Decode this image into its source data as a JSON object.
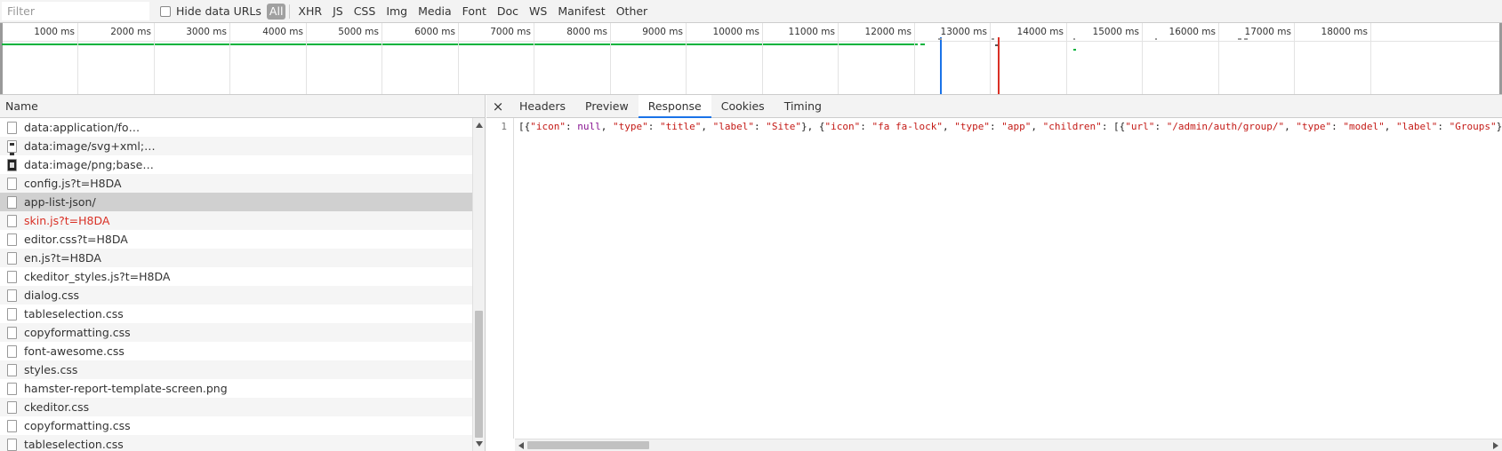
{
  "filterbar": {
    "filter_placeholder": "Filter",
    "hide_data_urls_label": "Hide data URLs",
    "types": [
      "All",
      "XHR",
      "JS",
      "CSS",
      "Img",
      "Media",
      "Font",
      "Doc",
      "WS",
      "Manifest",
      "Other"
    ],
    "active_type": "All"
  },
  "overview": {
    "ticks": [
      "1000 ms",
      "2000 ms",
      "3000 ms",
      "4000 ms",
      "5000 ms",
      "6000 ms",
      "7000 ms",
      "8000 ms",
      "9000 ms",
      "10000 ms",
      "11000 ms",
      "12000 ms",
      "13000 ms",
      "14000 ms",
      "15000 ms",
      "16000 ms",
      "17000 ms",
      "18000 ms"
    ],
    "dom_content_loaded_color": "#1a73e8",
    "load_color": "#d93025",
    "request_bar_color": "#00b33c"
  },
  "requests": {
    "header": "Name",
    "items": [
      {
        "name": "data:application/fo…",
        "icon": "file-icon",
        "state": "normal"
      },
      {
        "name": "data:image/svg+xml;…",
        "icon": "svg-file-icon",
        "state": "normal"
      },
      {
        "name": "data:image/png;base…",
        "icon": "png-file-icon",
        "state": "normal"
      },
      {
        "name": "config.js?t=H8DA",
        "icon": "file-icon",
        "state": "normal"
      },
      {
        "name": "app-list-json/",
        "icon": "file-icon",
        "state": "selected"
      },
      {
        "name": "skin.js?t=H8DA",
        "icon": "file-icon",
        "state": "error"
      },
      {
        "name": "editor.css?t=H8DA",
        "icon": "file-icon",
        "state": "normal"
      },
      {
        "name": "en.js?t=H8DA",
        "icon": "file-icon",
        "state": "normal"
      },
      {
        "name": "ckeditor_styles.js?t=H8DA",
        "icon": "file-icon",
        "state": "normal"
      },
      {
        "name": "dialog.css",
        "icon": "file-icon",
        "state": "normal"
      },
      {
        "name": "tableselection.css",
        "icon": "file-icon",
        "state": "normal"
      },
      {
        "name": "copyformatting.css",
        "icon": "file-icon",
        "state": "normal"
      },
      {
        "name": "font-awesome.css",
        "icon": "file-icon",
        "state": "normal"
      },
      {
        "name": "styles.css",
        "icon": "file-icon",
        "state": "normal"
      },
      {
        "name": "hamster-report-template-screen.png",
        "icon": "file-icon",
        "state": "normal"
      },
      {
        "name": "ckeditor.css",
        "icon": "file-icon",
        "state": "normal"
      },
      {
        "name": "copyformatting.css",
        "icon": "file-icon",
        "state": "normal"
      },
      {
        "name": "tableselection.css",
        "icon": "file-icon",
        "state": "normal"
      }
    ]
  },
  "detail": {
    "close_label": "×",
    "tabs": [
      "Headers",
      "Preview",
      "Response",
      "Cookies",
      "Timing"
    ],
    "active_tab": "Response",
    "line_number": "1",
    "response_tokens": [
      {
        "t": "punc",
        "v": "[{"
      },
      {
        "t": "str",
        "v": "\"icon\""
      },
      {
        "t": "punc",
        "v": ": "
      },
      {
        "t": "null",
        "v": "null"
      },
      {
        "t": "punc",
        "v": ", "
      },
      {
        "t": "str",
        "v": "\"type\""
      },
      {
        "t": "punc",
        "v": ": "
      },
      {
        "t": "str",
        "v": "\"title\""
      },
      {
        "t": "punc",
        "v": ", "
      },
      {
        "t": "str",
        "v": "\"label\""
      },
      {
        "t": "punc",
        "v": ": "
      },
      {
        "t": "str",
        "v": "\"Site\""
      },
      {
        "t": "punc",
        "v": "}, {"
      },
      {
        "t": "str",
        "v": "\"icon\""
      },
      {
        "t": "punc",
        "v": ": "
      },
      {
        "t": "str",
        "v": "\"fa fa-lock\""
      },
      {
        "t": "punc",
        "v": ", "
      },
      {
        "t": "str",
        "v": "\"type\""
      },
      {
        "t": "punc",
        "v": ": "
      },
      {
        "t": "str",
        "v": "\"app\""
      },
      {
        "t": "punc",
        "v": ", "
      },
      {
        "t": "str",
        "v": "\"children\""
      },
      {
        "t": "punc",
        "v": ": [{"
      },
      {
        "t": "str",
        "v": "\"url\""
      },
      {
        "t": "punc",
        "v": ": "
      },
      {
        "t": "str",
        "v": "\"/admin/auth/group/\""
      },
      {
        "t": "punc",
        "v": ", "
      },
      {
        "t": "str",
        "v": "\"type\""
      },
      {
        "t": "punc",
        "v": ": "
      },
      {
        "t": "str",
        "v": "\"model\""
      },
      {
        "t": "punc",
        "v": ", "
      },
      {
        "t": "str",
        "v": "\"label\""
      },
      {
        "t": "punc",
        "v": ": "
      },
      {
        "t": "str",
        "v": "\"Groups\""
      },
      {
        "t": "punc",
        "v": "}"
      }
    ]
  }
}
